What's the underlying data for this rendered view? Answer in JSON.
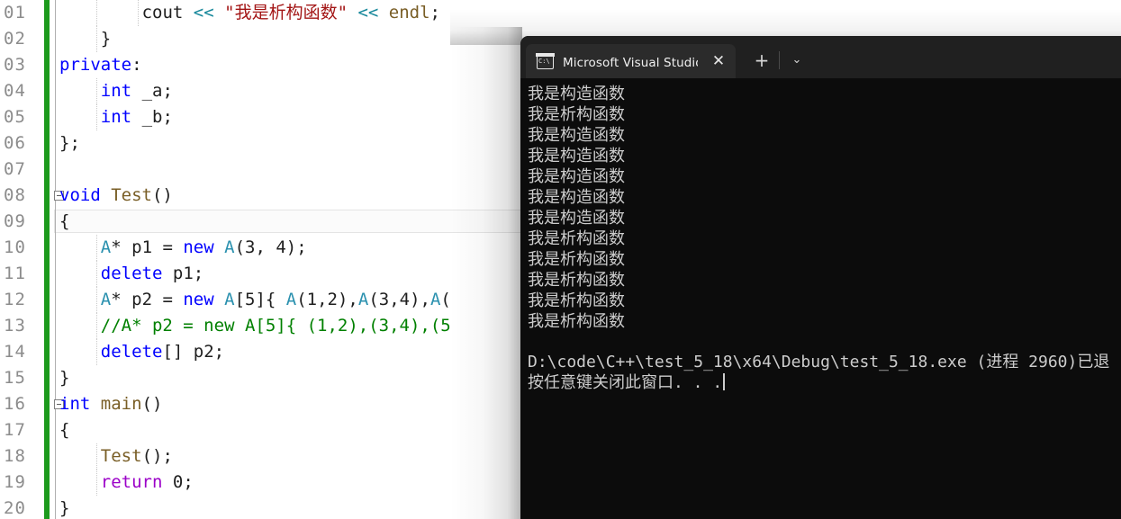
{
  "editor": {
    "line_number_format": "zero-padded-2",
    "change_bar_color": "#1d9a1d",
    "background": "#ffffff",
    "lines": [
      {
        "num": "01",
        "indent": 8,
        "tokens": [
          {
            "t": "cout ",
            "c": "plain"
          },
          {
            "t": "<< ",
            "c": "op-teal"
          },
          {
            "t": "\"我是析构函数\"",
            "c": "str-red"
          },
          {
            "t": " << ",
            "c": "op-teal"
          },
          {
            "t": "endl",
            "c": "fn-brown"
          },
          {
            "t": ";",
            "c": "plain"
          }
        ]
      },
      {
        "num": "02",
        "indent": 4,
        "tokens": [
          {
            "t": "}",
            "c": "plain"
          }
        ]
      },
      {
        "num": "03",
        "indent": 0,
        "tokens": [
          {
            "t": "private",
            "c": "kw-blue"
          },
          {
            "t": ":",
            "c": "plain"
          }
        ]
      },
      {
        "num": "04",
        "indent": 4,
        "tokens": [
          {
            "t": "int",
            "c": "kw-blue"
          },
          {
            "t": " _a;",
            "c": "plain"
          }
        ]
      },
      {
        "num": "05",
        "indent": 4,
        "tokens": [
          {
            "t": "int",
            "c": "kw-blue"
          },
          {
            "t": " _b;",
            "c": "plain"
          }
        ]
      },
      {
        "num": "06",
        "indent": 0,
        "tokens": [
          {
            "t": "};",
            "c": "plain"
          }
        ]
      },
      {
        "num": "07",
        "indent": 0,
        "tokens": []
      },
      {
        "num": "08",
        "indent": 0,
        "fold": true,
        "tokens": [
          {
            "t": "void",
            "c": "kw-blue"
          },
          {
            "t": " ",
            "c": "plain"
          },
          {
            "t": "Test",
            "c": "fn-brown"
          },
          {
            "t": "()",
            "c": "plain"
          }
        ]
      },
      {
        "num": "09",
        "indent": 0,
        "current": true,
        "tokens": [
          {
            "t": "{",
            "c": "plain"
          }
        ]
      },
      {
        "num": "10",
        "indent": 4,
        "tokens": [
          {
            "t": "A",
            "c": "type-teal"
          },
          {
            "t": "* p1 = ",
            "c": "plain"
          },
          {
            "t": "new",
            "c": "kw-blue"
          },
          {
            "t": " ",
            "c": "plain"
          },
          {
            "t": "A",
            "c": "type-teal"
          },
          {
            "t": "(3, 4);",
            "c": "plain"
          }
        ]
      },
      {
        "num": "11",
        "indent": 4,
        "tokens": [
          {
            "t": "delete",
            "c": "kw-blue"
          },
          {
            "t": " p1;",
            "c": "plain"
          }
        ]
      },
      {
        "num": "12",
        "indent": 4,
        "tokens": [
          {
            "t": "A",
            "c": "type-teal"
          },
          {
            "t": "* p2 = ",
            "c": "plain"
          },
          {
            "t": "new",
            "c": "kw-blue"
          },
          {
            "t": " ",
            "c": "plain"
          },
          {
            "t": "A",
            "c": "type-teal"
          },
          {
            "t": "[5]{ ",
            "c": "plain"
          },
          {
            "t": "A",
            "c": "type-teal"
          },
          {
            "t": "(1,2),",
            "c": "plain"
          },
          {
            "t": "A",
            "c": "type-teal"
          },
          {
            "t": "(3,4),",
            "c": "plain"
          },
          {
            "t": "A",
            "c": "type-teal"
          },
          {
            "t": "(",
            "c": "plain"
          }
        ]
      },
      {
        "num": "13",
        "indent": 4,
        "tokens": [
          {
            "t": "//A* p2 = new A[5]{ (1,2),(3,4),(5",
            "c": "cmt-green"
          }
        ]
      },
      {
        "num": "14",
        "indent": 4,
        "tokens": [
          {
            "t": "delete",
            "c": "kw-blue"
          },
          {
            "t": "[] p2;",
            "c": "plain"
          }
        ]
      },
      {
        "num": "15",
        "indent": 0,
        "tokens": [
          {
            "t": "}",
            "c": "plain"
          }
        ]
      },
      {
        "num": "16",
        "indent": 0,
        "fold": true,
        "tokens": [
          {
            "t": "int",
            "c": "kw-blue"
          },
          {
            "t": " ",
            "c": "plain"
          },
          {
            "t": "main",
            "c": "fn-brown"
          },
          {
            "t": "()",
            "c": "plain"
          }
        ]
      },
      {
        "num": "17",
        "indent": 0,
        "tokens": [
          {
            "t": "{",
            "c": "plain"
          }
        ]
      },
      {
        "num": "18",
        "indent": 4,
        "tokens": [
          {
            "t": "Test",
            "c": "fn-brown"
          },
          {
            "t": "();",
            "c": "plain"
          }
        ]
      },
      {
        "num": "19",
        "indent": 4,
        "tokens": [
          {
            "t": "return",
            "c": "kw-purple"
          },
          {
            "t": " 0;",
            "c": "plain"
          }
        ]
      },
      {
        "num": "20",
        "indent": 0,
        "tokens": [
          {
            "t": "}",
            "c": "plain"
          }
        ]
      }
    ]
  },
  "console": {
    "tab_title": "Microsoft Visual Studio 调试控制台",
    "tab_icon": "console-window-icon",
    "close_label": "✕",
    "new_tab_label": "+",
    "chevron_label": "⌄",
    "background": "#0c0c0c",
    "titlebar_background": "#202020",
    "text_color": "#cccccc",
    "output_lines": [
      "我是构造函数",
      "我是析构函数",
      "我是构造函数",
      "我是构造函数",
      "我是构造函数",
      "我是构造函数",
      "我是构造函数",
      "我是析构函数",
      "我是析构函数",
      "我是析构函数",
      "我是析构函数",
      "我是析构函数"
    ],
    "exit_line": "D:\\code\\C++\\test_5_18\\x64\\Debug\\test_5_18.exe (进程 2960)已退",
    "prompt_line": "按任意键关闭此窗口. . ."
  }
}
